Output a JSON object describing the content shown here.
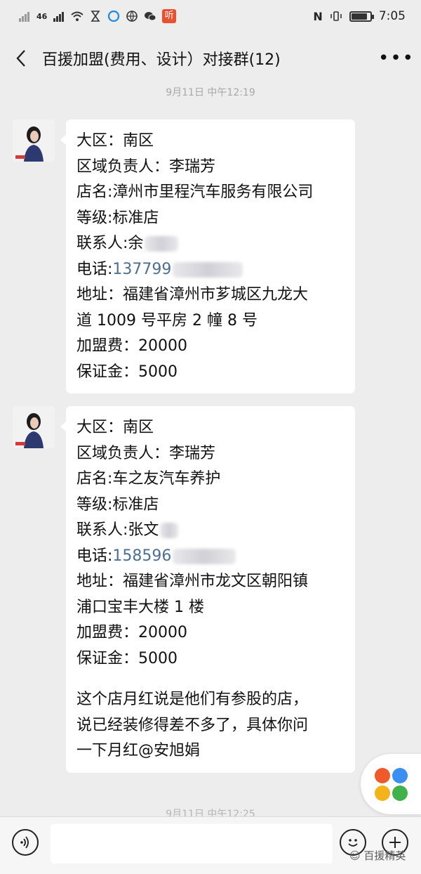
{
  "status_bar": {
    "network": "46",
    "listen_badge": "听",
    "time": "7:05",
    "battery_level_percent": 88
  },
  "header": {
    "title": "百援加盟(费用、设计）对接群(12)"
  },
  "timestamps": {
    "first": "9月11日 中午12:19",
    "second": "9月11日 中午12:25"
  },
  "messages": [
    {
      "lines": [
        "大区：南区",
        "区域负责人：李瑞芳",
        "店名:漳州市里程汽车服务有限公司",
        "等级:标准店"
      ],
      "contact": "联系人:余",
      "phone_label": "电话:",
      "phone": "137799",
      "address": [
        "地址：福建省漳州市芗城区九龙大",
        "道 1009 号平房 2 幢 8 号"
      ],
      "fee": "加盟费：20000",
      "deposit": "保证金：5000"
    },
    {
      "lines": [
        "大区：南区",
        "区域负责人：李瑞芳",
        "店名:车之友汽车养护",
        "等级:标准店"
      ],
      "contact": "联系人:张文",
      "phone_label": "电话:",
      "phone": "158596",
      "address": [
        "地址：福建省漳州市龙文区朝阳镇",
        "浦口宝丰大楼 1 楼"
      ],
      "fee": "加盟费：20000",
      "deposit": "保证金：5000",
      "note": [
        "这个店月红说是他们有参股的店，",
        "说已经装修得差不多了，具体你问",
        "一下月红@安旭娟"
      ]
    }
  ],
  "watermark": "百援精英",
  "colors": {
    "background": "#ededed",
    "bubble": "#ffffff",
    "phone_link": "#4d6f93",
    "badge_red": "#e8502f"
  }
}
